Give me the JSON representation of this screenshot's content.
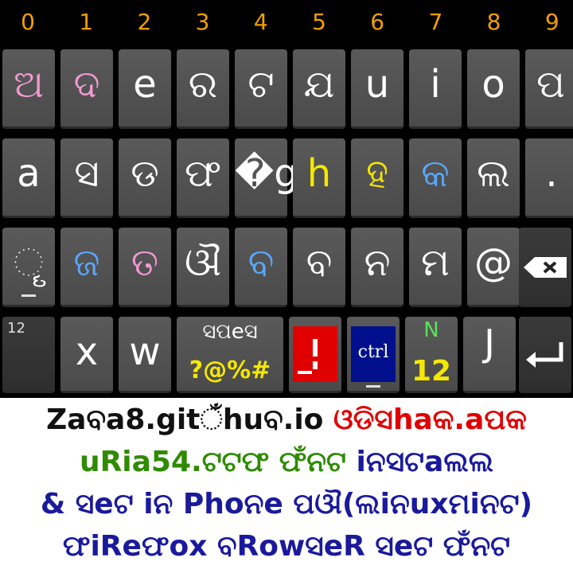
{
  "digits": [
    "0",
    "1",
    "2",
    "3",
    "4",
    "5",
    "6",
    "7",
    "8",
    "9"
  ],
  "rows": [
    [
      {
        "label": "ଅ",
        "color": "#f29ad2"
      },
      {
        "label": "ଦ",
        "color": "#f29ad2"
      },
      {
        "label": "e",
        "color": "#ffffff"
      },
      {
        "label": "ର",
        "color": "#ffffff"
      },
      {
        "label": "ଟ",
        "color": "#ffffff"
      },
      {
        "label": "ଯ",
        "color": "#ffffff"
      },
      {
        "label": "u",
        "color": "#ffffff"
      },
      {
        "label": "i",
        "color": "#ffffff"
      },
      {
        "label": "o",
        "color": "#ffffff"
      },
      {
        "label": "ପ",
        "color": "#ffffff"
      }
    ],
    [
      {
        "label": "a",
        "color": "#ffffff"
      },
      {
        "label": "ସ",
        "color": "#ffffff"
      },
      {
        "label": "ଡ",
        "color": "#ffffff"
      },
      {
        "label": "ଫ",
        "color": "#ffffff"
      },
      {
        "label": "�g",
        "color": "#ffffff"
      },
      {
        "label": "h",
        "color": "#f5e800"
      },
      {
        "label": "ହ",
        "color": "#f5e800"
      },
      {
        "label": "କ",
        "color": "#5aa8ff"
      },
      {
        "label": "ଲ",
        "color": "#ffffff"
      },
      {
        "label": ".",
        "color": "#ffffff"
      }
    ],
    [
      {
        "label": "ୄ",
        "color": "#ffffff"
      },
      {
        "label": "ଜ",
        "color": "#5aa8ff"
      },
      {
        "label": "ତ",
        "color": "#f29ad2"
      },
      {
        "label": "ଔ",
        "color": "#ffffff"
      },
      {
        "label": "ବ",
        "color": "#5aa8ff"
      },
      {
        "label": "ବ",
        "color": "#ffffff"
      },
      {
        "label": "ନ",
        "color": "#ffffff"
      },
      {
        "label": "ମ",
        "color": "#ffffff"
      },
      {
        "label": "@",
        "color": "#ffffff"
      }
    ]
  ],
  "bottom_row": {
    "symbols_small": "12",
    "x_label": "x",
    "w_label": "w",
    "space_top": "ସପeସ",
    "space_bottom": "?@%#",
    "ctrl_label": "ctrl",
    "num_top": "N",
    "num_bottom": "12",
    "j_label": "J"
  },
  "texts": [
    {
      "parts": [
        {
          "t": "Zaବa8.gitଁhuବ.io ",
          "c": "#111111"
        },
        {
          "t": "ଓଡିସhaକ.aପକ",
          "c": "#e00000"
        }
      ]
    },
    {
      "parts": [
        {
          "t": "uRia54.ଟଟଫ ଫଁନଟ ",
          "c": "#2e8b00"
        },
        {
          "t": "iନସଟaଲଲ",
          "c": "#1a1a9c"
        }
      ]
    },
    {
      "parts": [
        {
          "t": "& ସeଟ iନ Phoନe ପଔ(ଲiନuxମiନଟ)",
          "c": "#1a1a9c"
        }
      ]
    },
    {
      "parts": [
        {
          "t": "ଫiReଫox ବRowସeR ସeଟ ଫଁନଟ",
          "c": "#1a1a9c"
        }
      ]
    }
  ]
}
